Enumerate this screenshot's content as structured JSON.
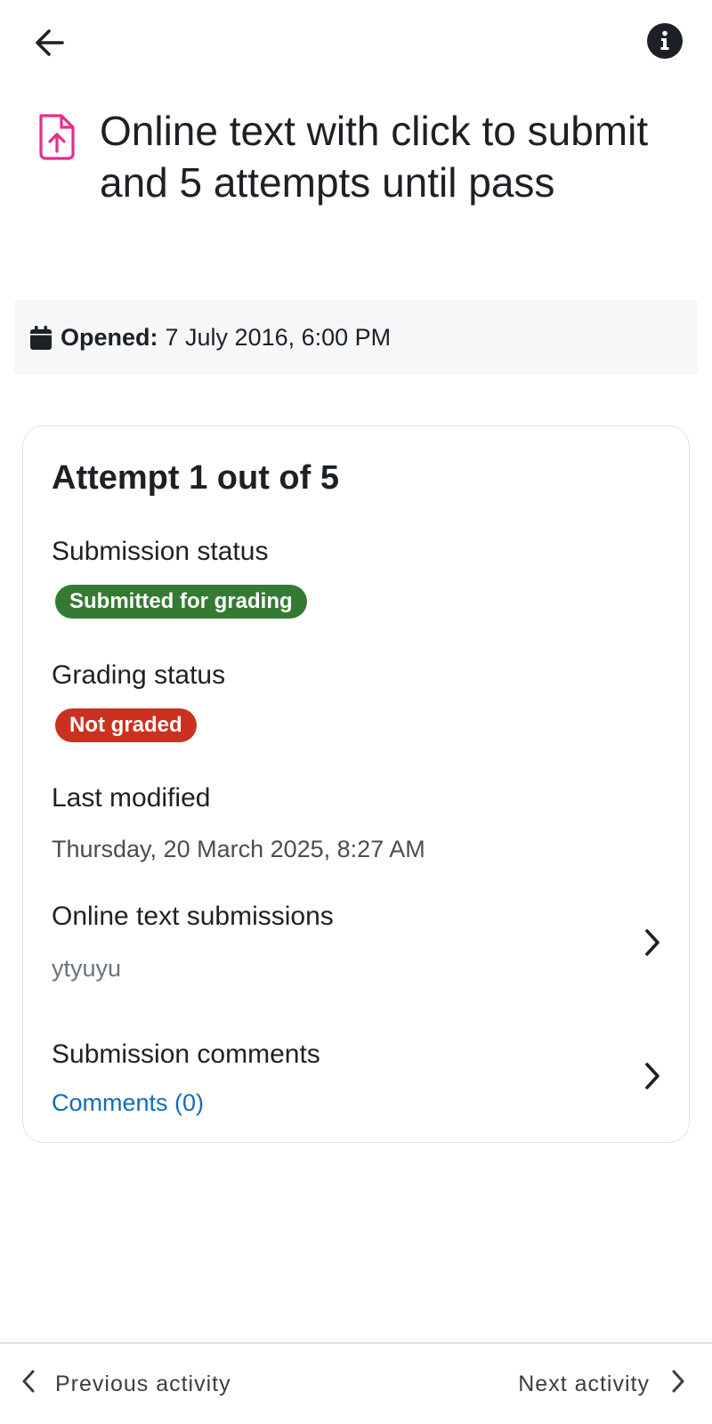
{
  "header": {
    "back_icon": "arrow-left-icon",
    "info_icon": "info-circle-icon"
  },
  "activity": {
    "icon": "assignment-upload-icon",
    "icon_color": "#e52c8c",
    "title": "Online text with click to submit and 5 attempts until pass"
  },
  "dates": {
    "icon": "calendar-icon",
    "opened_label": "Opened:",
    "opened_value": "7 July 2016, 6:00 PM"
  },
  "attempt": {
    "title": "Attempt 1 out of 5",
    "submission_status": {
      "label": "Submission status",
      "badge": "Submitted for grading",
      "badge_color": "#357a32"
    },
    "grading_status": {
      "label": "Grading status",
      "badge": "Not graded",
      "badge_color": "#ca3120"
    },
    "last_modified": {
      "label": "Last modified",
      "value": "Thursday, 20 March 2025, 8:27 AM"
    },
    "online_text": {
      "label": "Online text submissions",
      "value": "ytyuyu"
    },
    "comments": {
      "label": "Submission comments",
      "link": "Comments (0)"
    }
  },
  "footer": {
    "prev_label": "Previous activity",
    "next_label": "Next activity"
  },
  "colors": {
    "link": "#0f6cbf",
    "text": "#1d2125",
    "border": "#dee2e6"
  }
}
